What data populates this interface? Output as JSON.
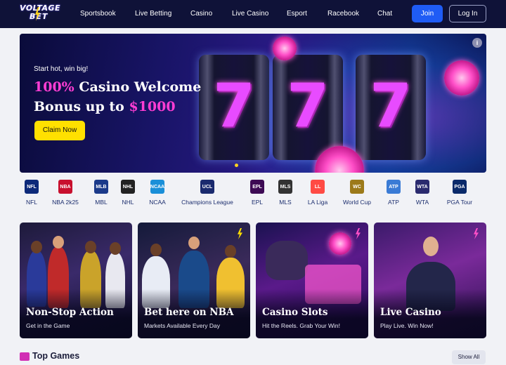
{
  "brand": {
    "logo_line1": "VOLTAGE",
    "logo_line2": "BET"
  },
  "nav": {
    "links": [
      "Sportsbook",
      "Live Betting",
      "Casino",
      "Live Casino",
      "Esport",
      "Racebook",
      "Chat"
    ],
    "join_label": "Join",
    "login_label": "Log In"
  },
  "hero": {
    "pretitle": "Start hot, win big!",
    "title_highlight_1": "100%",
    "title_part_1": " Casino Welcome",
    "title_part_2": "Bonus up to ",
    "title_highlight_2": "$1000",
    "cta_label": "Claim Now",
    "info_icon": "i",
    "reel_symbol": "7"
  },
  "leagues": [
    {
      "label": "NFL",
      "icon": "NFL",
      "color": "#0d2a7a"
    },
    {
      "label": "NBA 2k25",
      "icon": "NBA",
      "color": "#c8102e"
    },
    {
      "label": "MBL",
      "icon": "MLB",
      "color": "#1b3a8a"
    },
    {
      "label": "NHL",
      "icon": "NHL",
      "color": "#222222"
    },
    {
      "label": "NCAA",
      "icon": "NCAA",
      "color": "#1a8fd8"
    },
    {
      "label": "Champions League",
      "icon": "UCL",
      "color": "#1a2a6e"
    },
    {
      "label": "EPL",
      "icon": "EPL",
      "color": "#3d0a54"
    },
    {
      "label": "MLS",
      "icon": "MLS",
      "color": "#333333"
    },
    {
      "label": "LA Liga",
      "icon": "LL",
      "color": "#ff4b44"
    },
    {
      "label": "World Cup",
      "icon": "WC",
      "color": "#9c7a1a"
    },
    {
      "label": "ATP",
      "icon": "ATP",
      "color": "#3a7bd5"
    },
    {
      "label": "WTA",
      "icon": "WTA",
      "color": "#2a2a6e"
    },
    {
      "label": "PGA Tour",
      "icon": "PGA",
      "color": "#0a2a6a"
    }
  ],
  "cards": [
    {
      "title": "Non-Stop Action",
      "subtitle": "Get in the Game"
    },
    {
      "title": "Bet here on NBA",
      "subtitle": "Markets Available Every Day"
    },
    {
      "title": "Casino Slots",
      "subtitle": "Hit the Reels. Grab Your Win!"
    },
    {
      "title": "Live Casino",
      "subtitle": "Play Live. Win Now!"
    }
  ],
  "top_games": {
    "title": "Top Games",
    "show_all_label": "Show All"
  },
  "colors": {
    "nav_bg": "#0f1238",
    "accent_blue": "#1f5cf5",
    "cta_yellow": "#ffe000",
    "highlight_pink": "#ff3dd4"
  }
}
